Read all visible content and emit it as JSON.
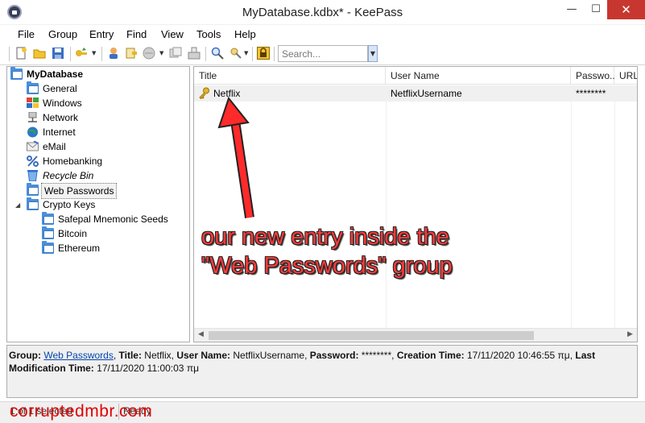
{
  "window": {
    "title": "MyDatabase.kdbx* - KeePass",
    "minimize_glyph": "—",
    "maximize_glyph": "☐",
    "close_glyph": "✕"
  },
  "menu": [
    "File",
    "Group",
    "Entry",
    "Find",
    "View",
    "Tools",
    "Help"
  ],
  "toolbar": {
    "search_placeholder": "Search...",
    "icons": [
      "new-database-icon",
      "open-database-icon",
      "save-database-icon",
      "add-entry-icon",
      "edit-entry-icon",
      "copy-username-icon",
      "copy-password-icon",
      "open-url-icon",
      "autotype-icon",
      "find-icon",
      "tools-icon",
      "lock-workspace-icon"
    ]
  },
  "tree": {
    "root": "MyDatabase",
    "groups": [
      {
        "label": "General",
        "icon": "folder-icon"
      },
      {
        "label": "Windows",
        "icon": "windows-icon"
      },
      {
        "label": "Network",
        "icon": "network-icon"
      },
      {
        "label": "Internet",
        "icon": "globe-icon"
      },
      {
        "label": "eMail",
        "icon": "email-icon"
      },
      {
        "label": "Homebanking",
        "icon": "percent-icon"
      },
      {
        "label": "Recycle Bin",
        "icon": "recycle-bin-icon"
      },
      {
        "label": "Web Passwords",
        "icon": "folder-icon"
      },
      {
        "label": "Crypto Keys",
        "icon": "folder-icon"
      }
    ],
    "crypto_children": [
      "Safepal Mnemonic Seeds",
      "Bitcoin",
      "Ethereum"
    ],
    "expander_glyph": "◢"
  },
  "list": {
    "columns": [
      "Title",
      "User Name",
      "Passwo...",
      "URL"
    ],
    "rows": [
      {
        "title": "Netflix",
        "username": "NetflixUsername",
        "password": "********",
        "url": ""
      }
    ],
    "scroll_left": "◀",
    "scroll_right": "▶"
  },
  "annotation": {
    "line1": "our new entry inside the",
    "line2": "\"Web Passwords\" group",
    "color": "#ff3b3b"
  },
  "details": {
    "group_label": "Group:",
    "group_value": "Web Passwords",
    "title_label": "Title:",
    "title_value": "Netflix,",
    "user_label": "User Name:",
    "user_value": "NetflixUsername,",
    "password_label": "Password:",
    "password_value": "********,",
    "created_label": "Creation Time:",
    "created_value": "17/11/2020 10:46:55 πμ,",
    "modified_label": "Last Modification",
    "time_label": "Time:",
    "time_value": "17/11/2020 11:00:03 πμ"
  },
  "status": {
    "selection": "1 of 1 selected",
    "state": "Ready"
  },
  "watermark": "corruptedmbr.com",
  "colors": {
    "accent": "#4a8fdc",
    "close_button": "#c7372f",
    "watermark": "#e00000"
  }
}
